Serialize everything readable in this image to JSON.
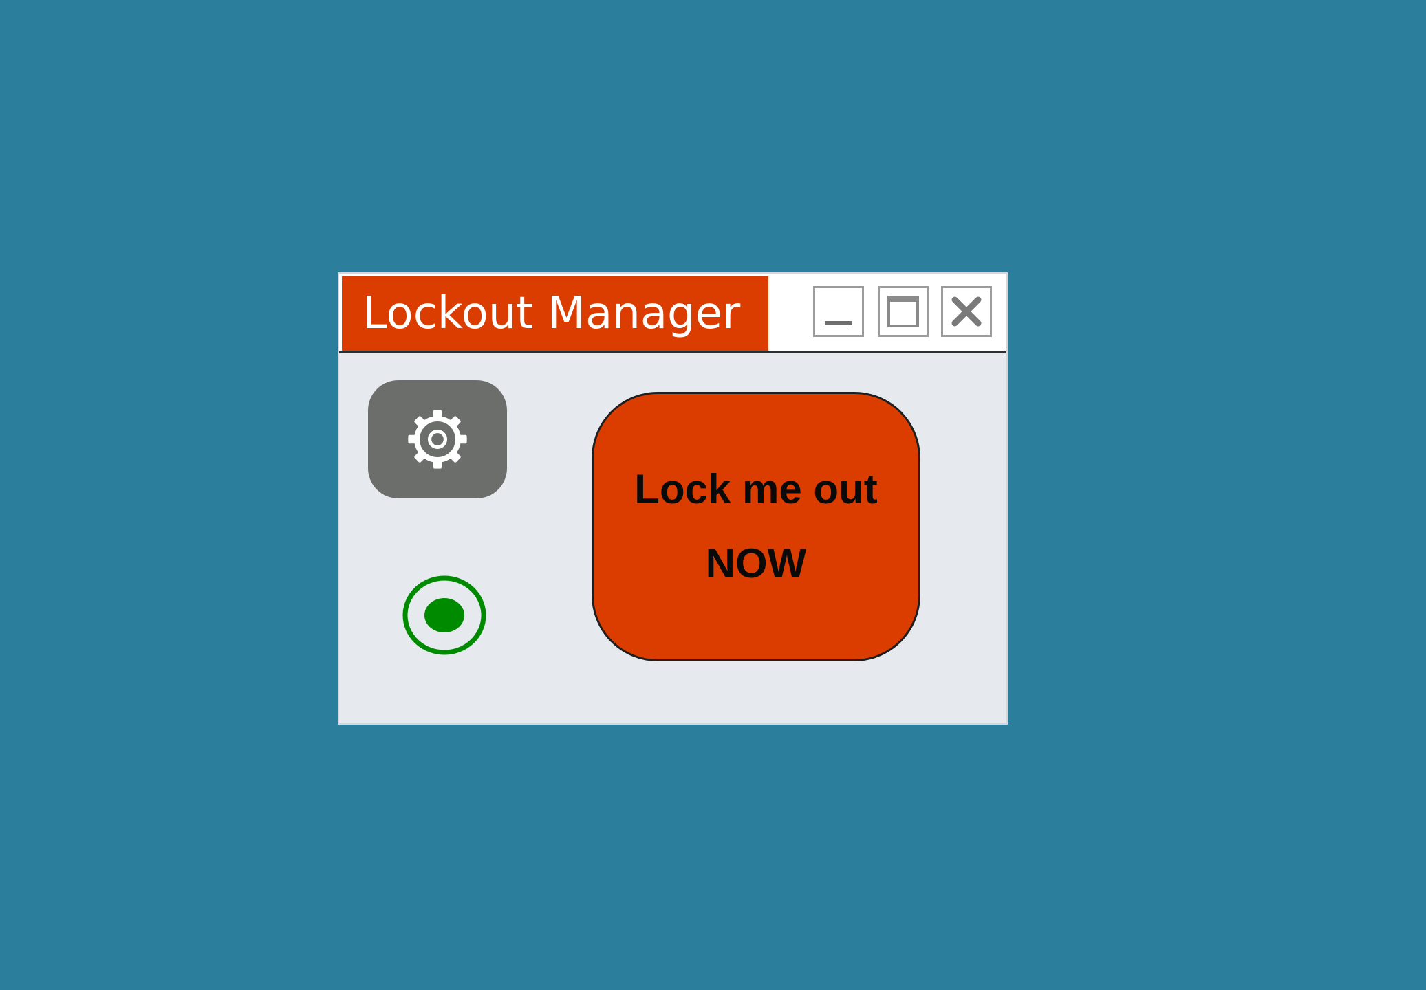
{
  "window": {
    "title": "Lockout Manager",
    "controls": {
      "minimize_icon": "minimize-icon",
      "maximize_icon": "maximize-icon",
      "close_icon": "close-icon"
    }
  },
  "settings": {
    "icon": "gear-icon"
  },
  "status": {
    "icon": "radio-indicator-icon",
    "color": "#008a00"
  },
  "lock_button": {
    "line1": "Lock me out",
    "line2": "NOW"
  },
  "colors": {
    "desktop": "#2b7e9c",
    "accent": "#db3d00",
    "window_body": "#e6e9ee",
    "settings_button": "#6b6e6b"
  }
}
